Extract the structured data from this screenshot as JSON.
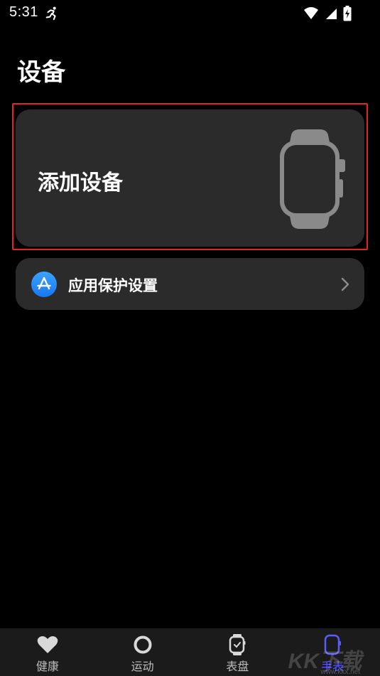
{
  "status_bar": {
    "time": "5:31",
    "icons": [
      "running-icon",
      "wifi-icon",
      "signal-icon",
      "battery-charging-icon"
    ]
  },
  "page": {
    "title": "设备"
  },
  "add_device_card": {
    "label": "添加设备",
    "icon": "smartwatch-icon"
  },
  "protect_row": {
    "label": "应用保护设置",
    "icon": "app-store-icon",
    "chevron": "chevron-right-icon"
  },
  "tab_bar": {
    "tabs": [
      {
        "label": "健康",
        "icon": "heart-icon",
        "active": false
      },
      {
        "label": "运动",
        "icon": "ring-icon",
        "active": false
      },
      {
        "label": "表盘",
        "icon": "watch-face-icon",
        "active": false
      },
      {
        "label": "手表",
        "icon": "watch-icon",
        "active": true
      }
    ],
    "active_color": "#5b5bff"
  },
  "watermark": {
    "text": "KK下载",
    "sub": "www.kkx.net"
  },
  "colors": {
    "background": "#000000",
    "card": "#2b2b2b",
    "highlight_outline": "#e0261e",
    "accent_blue": "#1877f2"
  }
}
